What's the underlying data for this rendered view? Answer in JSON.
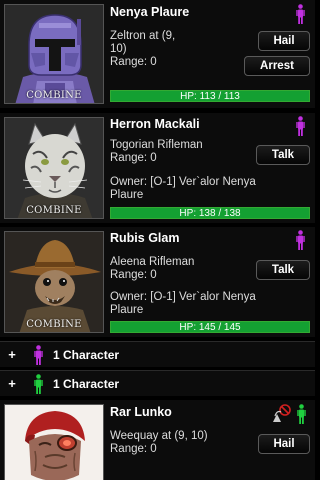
{
  "colors": {
    "panel_bg": "#0c0c0c",
    "hp_green": "#14a032",
    "person_magenta": "#c030e0",
    "person_green": "#20d040"
  },
  "characters": [
    {
      "name": "Nenya Plaure",
      "info_line1": "Zeltron at (9,",
      "info_line2": "10)",
      "range": "Range: 0",
      "portrait_label": "COMBINE",
      "buttons": [
        "Hail",
        "Arrest"
      ],
      "hp_text": "HP: 113 / 113",
      "hp_fraction": 1.0,
      "person_icon": "person-icon-magenta"
    },
    {
      "name": "Herron Mackali",
      "info_line1": "Togorian Rifleman",
      "range": "Range: 0",
      "owner_line1": "Owner: [O-1] Ver`alor Nenya",
      "owner_line2": "Plaure",
      "portrait_label": "COMBINE",
      "buttons": [
        "Talk"
      ],
      "hp_text": "HP: 138 / 138",
      "hp_fraction": 1.0,
      "person_icon": "person-icon-magenta"
    },
    {
      "name": "Rubis Glam",
      "info_line1": "Aleena Rifleman",
      "range": "Range: 0",
      "owner_line1": "Owner: [O-1] Ver`alor Nenya",
      "owner_line2": "Plaure",
      "portrait_label": "COMBINE",
      "buttons": [
        "Talk"
      ],
      "hp_text": "HP: 145 / 145",
      "hp_fraction": 1.0,
      "person_icon": "person-icon-magenta"
    },
    {
      "name": "Rar Lunko",
      "info_line1": "Weequay at (9, 10)",
      "range": "Range: 0",
      "buttons": [
        "Hail"
      ],
      "person_icon": "person-icon-green",
      "extra_icon": "no-scan-icon"
    }
  ],
  "groups": [
    {
      "expand": "+",
      "label": "1 Character",
      "icon": "person-icon-magenta"
    },
    {
      "expand": "+",
      "label": "1 Character",
      "icon": "person-icon-green"
    }
  ]
}
